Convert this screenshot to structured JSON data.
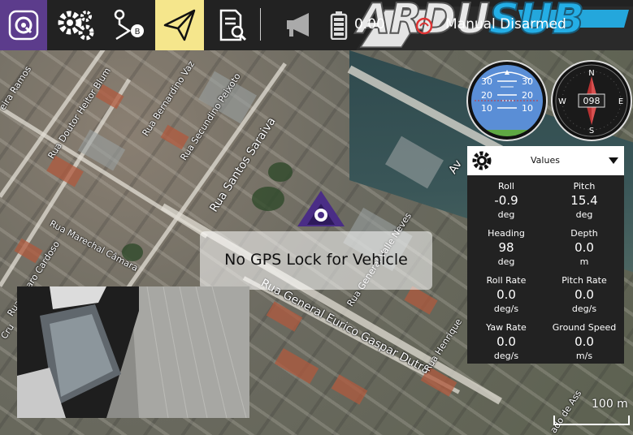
{
  "toolbar": {
    "buttons": [
      {
        "name": "app-logo",
        "icon": "qgc-logo-icon"
      },
      {
        "name": "settings",
        "icon": "gears-icon"
      },
      {
        "name": "plan",
        "icon": "route-icon"
      },
      {
        "name": "fly",
        "icon": "paper-plane-icon",
        "active": true
      },
      {
        "name": "analyze",
        "icon": "document-search-icon"
      }
    ],
    "message_icon": "megaphone-icon",
    "battery_icon": "battery-icon",
    "battery_text": "0.00",
    "mode_text": "Manual  Disarmed",
    "brand": {
      "part1": "ARDU",
      "part2": "SUB"
    }
  },
  "colors": {
    "toolbar_bg": "#222222",
    "active_button_bg": "#f5e68c",
    "logo_bg": "#5c3c8c",
    "brand_blue": "#24aee6",
    "vehicle_purple": "#4a2d86"
  },
  "map": {
    "streets": [
      "Rua Doutor Heitor Blum",
      "Rua Bernardino Vaz",
      "Rua Secundino Peixoto",
      "Rua Santos Saraiva",
      "Rua Marechal Câmara",
      "Rua Álvaro Cardoso",
      "Rua General Eurico Gaspar Dutra",
      "Rua General Valle Neves",
      "Rua Henrique",
      "eira Ramos",
      "Av",
      "Cru",
      "ado de Ass"
    ],
    "scale_label": "100 m"
  },
  "attitude": {
    "roll": -0.9,
    "pitch": 15.4,
    "pitch_ticks": [
      "30",
      "20",
      "10"
    ]
  },
  "compass": {
    "heading": 98,
    "heading_text": "098",
    "cardinals": {
      "n": "N",
      "e": "E",
      "s": "S",
      "w": "W"
    }
  },
  "values_panel": {
    "title": "Values",
    "gear_icon": "gear-icon",
    "dropdown_icon": "caret-down-icon",
    "items": [
      {
        "label": "Roll",
        "value": "-0.9",
        "unit": "deg"
      },
      {
        "label": "Pitch",
        "value": "15.4",
        "unit": "deg"
      },
      {
        "label": "Heading",
        "value": "98",
        "unit": "deg"
      },
      {
        "label": "Depth",
        "value": "0.0",
        "unit": "m"
      },
      {
        "label": "Roll Rate",
        "value": "0.0",
        "unit": "deg/s"
      },
      {
        "label": "Pitch Rate",
        "value": "0.0",
        "unit": "deg/s"
      },
      {
        "label": "Yaw Rate",
        "value": "0.0",
        "unit": "deg/s"
      },
      {
        "label": "Ground Speed",
        "value": "0.0",
        "unit": "m/s"
      }
    ]
  },
  "status": {
    "gps_message": "No GPS Lock for Vehicle"
  }
}
